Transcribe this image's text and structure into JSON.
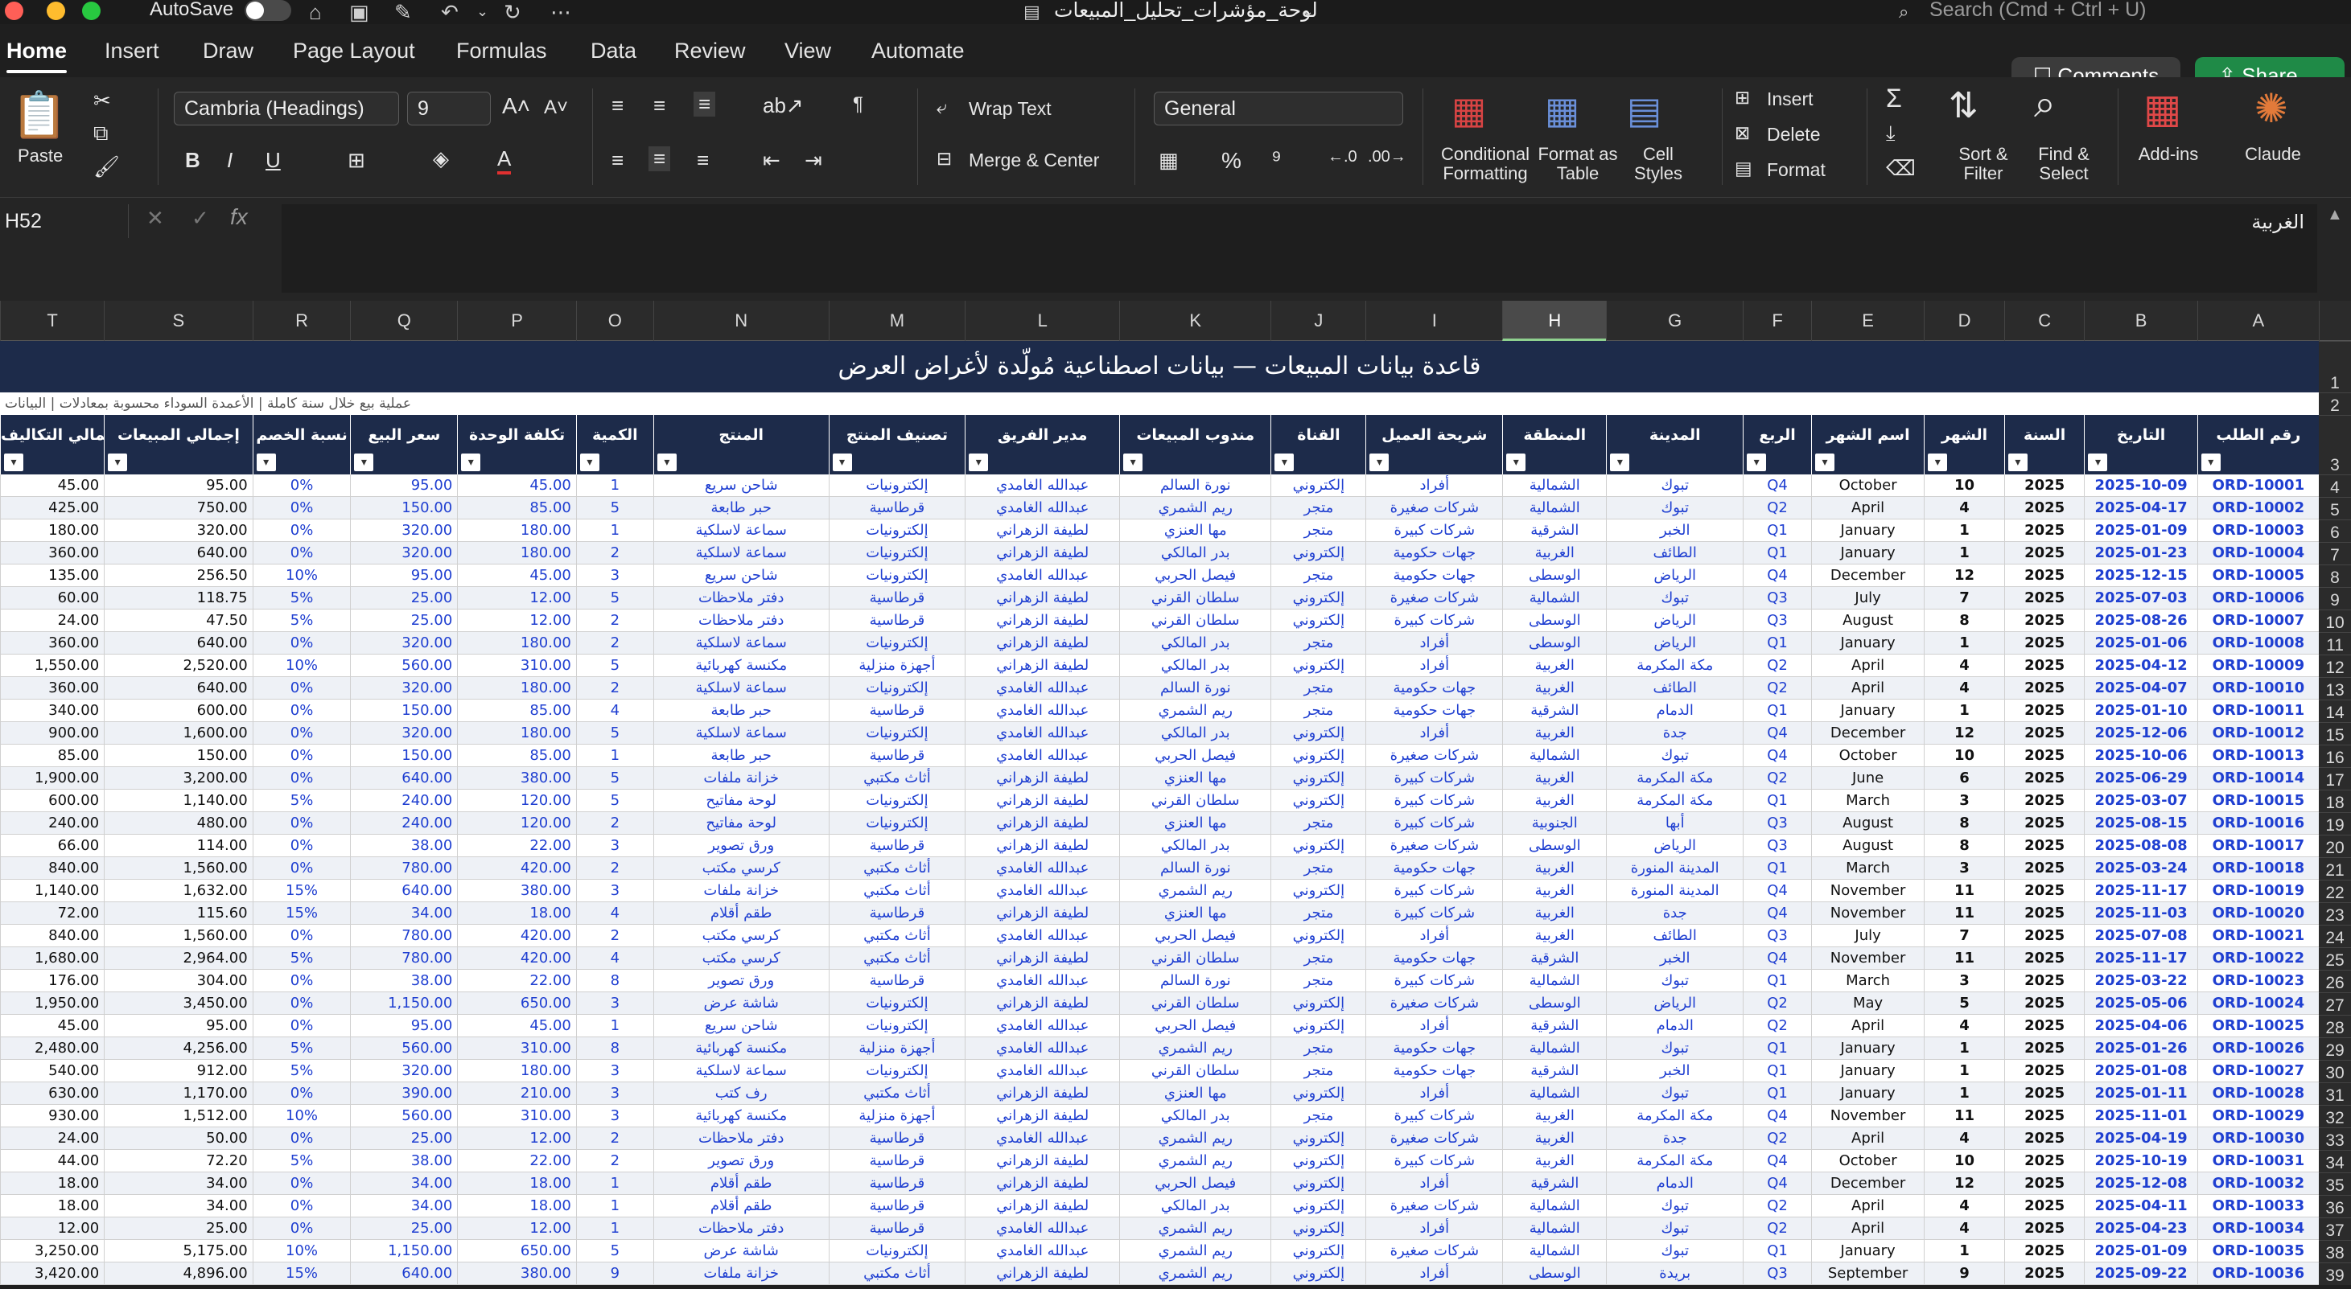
{
  "titlebar": {
    "autosave": "AutoSave",
    "doc_title": "لوحة_مؤشرات_تحليل_المبيعات",
    "search_placeholder": "Search (Cmd + Ctrl + U)"
  },
  "tabs": [
    "Home",
    "Insert",
    "Draw",
    "Page Layout",
    "Formulas",
    "Data",
    "Review",
    "View",
    "Automate"
  ],
  "actions": {
    "comments": "Comments",
    "share": "Share"
  },
  "ribbon": {
    "paste": "Paste",
    "font": "Cambria (Headings)",
    "size": "9",
    "wrap": "Wrap Text",
    "merge": "Merge & Center",
    "format": "General",
    "cond": "Conditional Formatting",
    "fmt_table": "Format as Table",
    "cell_styles": "Cell Styles",
    "insert": "Insert",
    "delete": "Delete",
    "format_cells": "Format",
    "sort": "Sort & Filter",
    "find": "Find & Select",
    "addins": "Add-ins",
    "claude": "Claude"
  },
  "formula_bar": {
    "name_box": "H52",
    "content": "الغربية"
  },
  "columns": [
    "T",
    "S",
    "R",
    "Q",
    "P",
    "O",
    "N",
    "M",
    "L",
    "K",
    "J",
    "I",
    "H",
    "G",
    "F",
    "E",
    "D",
    "C",
    "B",
    "A"
  ],
  "selected_column": "H",
  "row_numbers": [
    "1",
    "2",
    "3",
    "4",
    "5",
    "6",
    "7",
    "8",
    "9",
    "10",
    "11",
    "12",
    "13",
    "14",
    "15",
    "16",
    "17",
    "18",
    "19",
    "20",
    "21",
    "22",
    "23",
    "24",
    "25",
    "26",
    "27",
    "28",
    "29",
    "30",
    "31",
    "32",
    "33",
    "34",
    "35",
    "36",
    "37",
    "38",
    "39"
  ],
  "banner": "قاعدة بيانات المبيعات — بيانات اصطناعية مُولّدة لأغراض العرض",
  "note": "عملية بيع خلال سنة كاملة | الأعمدة السوداء محسوبة بمعادلات | البيانات",
  "headers": [
    "إجمالي التكاليف",
    "إجمالي المبيعات",
    "نسبة الخصم",
    "سعر البيع",
    "تكلفة الوحدة",
    "الكمية",
    "المنتج",
    "تصنيف المنتج",
    "مدير الفريق",
    "مندوب المبيعات",
    "القناة",
    "شريحة العميل",
    "المنطقة",
    "المدينة",
    "الربع",
    "اسم الشهر",
    "الشهر",
    "السنة",
    "التاريخ",
    "رقم الطلب"
  ],
  "rows": [
    [
      "45.00",
      "95.00",
      "0%",
      "95.00",
      "45.00",
      "1",
      "شاحن سريع",
      "إلكترونيات",
      "عبدالله الغامدي",
      "نورة السالم",
      "إلكتروني",
      "أفراد",
      "الشمالية",
      "تبوك",
      "Q4",
      "October",
      "10",
      "2025",
      "2025-10-09",
      "ORD-10001"
    ],
    [
      "425.00",
      "750.00",
      "0%",
      "150.00",
      "85.00",
      "5",
      "حبر طابعة",
      "قرطاسية",
      "عبدالله الغامدي",
      "ريم الشمري",
      "متجر",
      "شركات صغيرة",
      "الشمالية",
      "تبوك",
      "Q2",
      "April",
      "4",
      "2025",
      "2025-04-17",
      "ORD-10002"
    ],
    [
      "180.00",
      "320.00",
      "0%",
      "320.00",
      "180.00",
      "1",
      "سماعة لاسلكية",
      "إلكترونيات",
      "لطيفة الزهراني",
      "مها العنزي",
      "متجر",
      "شركات كبيرة",
      "الشرقية",
      "الخبر",
      "Q1",
      "January",
      "1",
      "2025",
      "2025-01-09",
      "ORD-10003"
    ],
    [
      "360.00",
      "640.00",
      "0%",
      "320.00",
      "180.00",
      "2",
      "سماعة لاسلكية",
      "إلكترونيات",
      "لطيفة الزهراني",
      "بدر المالكي",
      "إلكتروني",
      "جهات حكومية",
      "الغربية",
      "الطائف",
      "Q1",
      "January",
      "1",
      "2025",
      "2025-01-23",
      "ORD-10004"
    ],
    [
      "135.00",
      "256.50",
      "10%",
      "95.00",
      "45.00",
      "3",
      "شاحن سريع",
      "إلكترونيات",
      "عبدالله الغامدي",
      "فيصل الحربي",
      "متجر",
      "جهات حكومية",
      "الوسطى",
      "الرياض",
      "Q4",
      "December",
      "12",
      "2025",
      "2025-12-15",
      "ORD-10005"
    ],
    [
      "60.00",
      "118.75",
      "5%",
      "25.00",
      "12.00",
      "5",
      "دفتر ملاحظات",
      "قرطاسية",
      "لطيفة الزهراني",
      "سلطان القرني",
      "إلكتروني",
      "شركات صغيرة",
      "الشمالية",
      "تبوك",
      "Q3",
      "July",
      "7",
      "2025",
      "2025-07-03",
      "ORD-10006"
    ],
    [
      "24.00",
      "47.50",
      "5%",
      "25.00",
      "12.00",
      "2",
      "دفتر ملاحظات",
      "قرطاسية",
      "لطيفة الزهراني",
      "سلطان القرني",
      "إلكتروني",
      "شركات كبيرة",
      "الوسطى",
      "الرياض",
      "Q3",
      "August",
      "8",
      "2025",
      "2025-08-26",
      "ORD-10007"
    ],
    [
      "360.00",
      "640.00",
      "0%",
      "320.00",
      "180.00",
      "2",
      "سماعة لاسلكية",
      "إلكترونيات",
      "لطيفة الزهراني",
      "بدر المالكي",
      "متجر",
      "أفراد",
      "الوسطى",
      "الرياض",
      "Q1",
      "January",
      "1",
      "2025",
      "2025-01-06",
      "ORD-10008"
    ],
    [
      "1,550.00",
      "2,520.00",
      "10%",
      "560.00",
      "310.00",
      "5",
      "مكنسة كهربائية",
      "أجهزة منزلية",
      "لطيفة الزهراني",
      "بدر المالكي",
      "إلكتروني",
      "أفراد",
      "الغربية",
      "مكة المكرمة",
      "Q2",
      "April",
      "4",
      "2025",
      "2025-04-12",
      "ORD-10009"
    ],
    [
      "360.00",
      "640.00",
      "0%",
      "320.00",
      "180.00",
      "2",
      "سماعة لاسلكية",
      "إلكترونيات",
      "عبدالله الغامدي",
      "نورة السالم",
      "متجر",
      "جهات حكومية",
      "الغربية",
      "الطائف",
      "Q2",
      "April",
      "4",
      "2025",
      "2025-04-07",
      "ORD-10010"
    ],
    [
      "340.00",
      "600.00",
      "0%",
      "150.00",
      "85.00",
      "4",
      "حبر طابعة",
      "قرطاسية",
      "عبدالله الغامدي",
      "ريم الشمري",
      "متجر",
      "جهات حكومية",
      "الشرقية",
      "الدمام",
      "Q1",
      "January",
      "1",
      "2025",
      "2025-01-10",
      "ORD-10011"
    ],
    [
      "900.00",
      "1,600.00",
      "0%",
      "320.00",
      "180.00",
      "5",
      "سماعة لاسلكية",
      "إلكترونيات",
      "عبدالله الغامدي",
      "بدر المالكي",
      "إلكتروني",
      "أفراد",
      "الغربية",
      "جدة",
      "Q4",
      "December",
      "12",
      "2025",
      "2025-12-06",
      "ORD-10012"
    ],
    [
      "85.00",
      "150.00",
      "0%",
      "150.00",
      "85.00",
      "1",
      "حبر طابعة",
      "قرطاسية",
      "عبدالله الغامدي",
      "فيصل الحربي",
      "إلكتروني",
      "شركات صغيرة",
      "الشمالية",
      "تبوك",
      "Q4",
      "October",
      "10",
      "2025",
      "2025-10-06",
      "ORD-10013"
    ],
    [
      "1,900.00",
      "3,200.00",
      "0%",
      "640.00",
      "380.00",
      "5",
      "خزانة ملفات",
      "أثاث مكتبي",
      "لطيفة الزهراني",
      "مها العنزي",
      "إلكتروني",
      "شركات كبيرة",
      "الغربية",
      "مكة المكرمة",
      "Q2",
      "June",
      "6",
      "2025",
      "2025-06-29",
      "ORD-10014"
    ],
    [
      "600.00",
      "1,140.00",
      "5%",
      "240.00",
      "120.00",
      "5",
      "لوحة مفاتيح",
      "إلكترونيات",
      "لطيفة الزهراني",
      "سلطان القرني",
      "إلكتروني",
      "شركات كبيرة",
      "الغربية",
      "مكة المكرمة",
      "Q1",
      "March",
      "3",
      "2025",
      "2025-03-07",
      "ORD-10015"
    ],
    [
      "240.00",
      "480.00",
      "0%",
      "240.00",
      "120.00",
      "2",
      "لوحة مفاتيح",
      "إلكترونيات",
      "لطيفة الزهراني",
      "مها العنزي",
      "متجر",
      "شركات كبيرة",
      "الجنوبية",
      "أبها",
      "Q3",
      "August",
      "8",
      "2025",
      "2025-08-15",
      "ORD-10016"
    ],
    [
      "66.00",
      "114.00",
      "0%",
      "38.00",
      "22.00",
      "3",
      "ورق تصوير",
      "قرطاسية",
      "لطيفة الزهراني",
      "بدر المالكي",
      "إلكتروني",
      "شركات صغيرة",
      "الوسطى",
      "الرياض",
      "Q3",
      "August",
      "8",
      "2025",
      "2025-08-08",
      "ORD-10017"
    ],
    [
      "840.00",
      "1,560.00",
      "0%",
      "780.00",
      "420.00",
      "2",
      "كرسي مكتب",
      "أثاث مكتبي",
      "عبدالله الغامدي",
      "نورة السالم",
      "متجر",
      "جهات حكومية",
      "الغربية",
      "المدينة المنورة",
      "Q1",
      "March",
      "3",
      "2025",
      "2025-03-24",
      "ORD-10018"
    ],
    [
      "1,140.00",
      "1,632.00",
      "15%",
      "640.00",
      "380.00",
      "3",
      "خزانة ملفات",
      "أثاث مكتبي",
      "عبدالله الغامدي",
      "ريم الشمري",
      "إلكتروني",
      "شركات كبيرة",
      "الغربية",
      "المدينة المنورة",
      "Q4",
      "November",
      "11",
      "2025",
      "2025-11-17",
      "ORD-10019"
    ],
    [
      "72.00",
      "115.60",
      "15%",
      "34.00",
      "18.00",
      "4",
      "طقم أقلام",
      "قرطاسية",
      "لطيفة الزهراني",
      "مها العنزي",
      "متجر",
      "شركات كبيرة",
      "الغربية",
      "جدة",
      "Q4",
      "November",
      "11",
      "2025",
      "2025-11-03",
      "ORD-10020"
    ],
    [
      "840.00",
      "1,560.00",
      "0%",
      "780.00",
      "420.00",
      "2",
      "كرسي مكتب",
      "أثاث مكتبي",
      "عبدالله الغامدي",
      "فيصل الحربي",
      "إلكتروني",
      "أفراد",
      "الغربية",
      "الطائف",
      "Q3",
      "July",
      "7",
      "2025",
      "2025-07-08",
      "ORD-10021"
    ],
    [
      "1,680.00",
      "2,964.00",
      "5%",
      "780.00",
      "420.00",
      "4",
      "كرسي مكتب",
      "أثاث مكتبي",
      "لطيفة الزهراني",
      "سلطان القرني",
      "متجر",
      "جهات حكومية",
      "الشرقية",
      "الخبر",
      "Q4",
      "November",
      "11",
      "2025",
      "2025-11-17",
      "ORD-10022"
    ],
    [
      "176.00",
      "304.00",
      "0%",
      "38.00",
      "22.00",
      "8",
      "ورق تصوير",
      "قرطاسية",
      "عبدالله الغامدي",
      "نورة السالم",
      "متجر",
      "شركات كبيرة",
      "الشمالية",
      "تبوك",
      "Q1",
      "March",
      "3",
      "2025",
      "2025-03-22",
      "ORD-10023"
    ],
    [
      "1,950.00",
      "3,450.00",
      "0%",
      "1,150.00",
      "650.00",
      "3",
      "شاشة عرض",
      "إلكترونيات",
      "لطيفة الزهراني",
      "سلطان القرني",
      "إلكتروني",
      "شركات صغيرة",
      "الوسطى",
      "الرياض",
      "Q2",
      "May",
      "5",
      "2025",
      "2025-05-06",
      "ORD-10024"
    ],
    [
      "45.00",
      "95.00",
      "0%",
      "95.00",
      "45.00",
      "1",
      "شاحن سريع",
      "إلكترونيات",
      "عبدالله الغامدي",
      "فيصل الحربي",
      "إلكتروني",
      "أفراد",
      "الشرقية",
      "الدمام",
      "Q2",
      "April",
      "4",
      "2025",
      "2025-04-06",
      "ORD-10025"
    ],
    [
      "2,480.00",
      "4,256.00",
      "5%",
      "560.00",
      "310.00",
      "8",
      "مكنسة كهربائية",
      "أجهزة منزلية",
      "عبدالله الغامدي",
      "ريم الشمري",
      "متجر",
      "جهات حكومية",
      "الشمالية",
      "تبوك",
      "Q1",
      "January",
      "1",
      "2025",
      "2025-01-26",
      "ORD-10026"
    ],
    [
      "540.00",
      "912.00",
      "5%",
      "320.00",
      "180.00",
      "3",
      "سماعة لاسلكية",
      "إلكترونيات",
      "عبدالله الغامدي",
      "سلطان القرني",
      "متجر",
      "جهات حكومية",
      "الشرقية",
      "الخبر",
      "Q1",
      "January",
      "1",
      "2025",
      "2025-01-08",
      "ORD-10027"
    ],
    [
      "630.00",
      "1,170.00",
      "0%",
      "390.00",
      "210.00",
      "3",
      "رف كتب",
      "أثاث مكتبي",
      "لطيفة الزهراني",
      "مها العنزي",
      "إلكتروني",
      "أفراد",
      "الشمالية",
      "تبوك",
      "Q1",
      "January",
      "1",
      "2025",
      "2025-01-11",
      "ORD-10028"
    ],
    [
      "930.00",
      "1,512.00",
      "10%",
      "560.00",
      "310.00",
      "3",
      "مكنسة كهربائية",
      "أجهزة منزلية",
      "لطيفة الزهراني",
      "بدر المالكي",
      "متجر",
      "شركات كبيرة",
      "الغربية",
      "مكة المكرمة",
      "Q4",
      "November",
      "11",
      "2025",
      "2025-11-01",
      "ORD-10029"
    ],
    [
      "24.00",
      "50.00",
      "0%",
      "25.00",
      "12.00",
      "2",
      "دفتر ملاحظات",
      "قرطاسية",
      "عبدالله الغامدي",
      "ريم الشمري",
      "إلكتروني",
      "شركات صغيرة",
      "الغربية",
      "جدة",
      "Q2",
      "April",
      "4",
      "2025",
      "2025-04-19",
      "ORD-10030"
    ],
    [
      "44.00",
      "72.20",
      "5%",
      "38.00",
      "22.00",
      "2",
      "ورق تصوير",
      "قرطاسية",
      "لطيفة الزهراني",
      "ريم الشمري",
      "إلكتروني",
      "شركات كبيرة",
      "الغربية",
      "مكة المكرمة",
      "Q4",
      "October",
      "10",
      "2025",
      "2025-10-19",
      "ORD-10031"
    ],
    [
      "18.00",
      "34.00",
      "0%",
      "34.00",
      "18.00",
      "1",
      "طقم أقلام",
      "قرطاسية",
      "لطيفة الزهراني",
      "فيصل الحربي",
      "إلكتروني",
      "أفراد",
      "الشرقية",
      "الدمام",
      "Q4",
      "December",
      "12",
      "2025",
      "2025-12-08",
      "ORD-10032"
    ],
    [
      "18.00",
      "34.00",
      "0%",
      "34.00",
      "18.00",
      "1",
      "طقم أقلام",
      "قرطاسية",
      "لطيفة الزهراني",
      "بدر المالكي",
      "إلكتروني",
      "شركات صغيرة",
      "الشمالية",
      "تبوك",
      "Q2",
      "April",
      "4",
      "2025",
      "2025-04-11",
      "ORD-10033"
    ],
    [
      "12.00",
      "25.00",
      "0%",
      "25.00",
      "12.00",
      "1",
      "دفتر ملاحظات",
      "قرطاسية",
      "عبدالله الغامدي",
      "ريم الشمري",
      "إلكتروني",
      "أفراد",
      "الشمالية",
      "تبوك",
      "Q2",
      "April",
      "4",
      "2025",
      "2025-04-23",
      "ORD-10034"
    ],
    [
      "3,250.00",
      "5,175.00",
      "10%",
      "1,150.00",
      "650.00",
      "5",
      "شاشة عرض",
      "إلكترونيات",
      "عبدالله الغامدي",
      "ريم الشمري",
      "إلكتروني",
      "شركات صغيرة",
      "الشمالية",
      "تبوك",
      "Q1",
      "January",
      "1",
      "2025",
      "2025-01-09",
      "ORD-10035"
    ],
    [
      "3,420.00",
      "4,896.00",
      "15%",
      "640.00",
      "380.00",
      "9",
      "خزانة ملفات",
      "أثاث مكتبي",
      "لطيفة الزهراني",
      "ريم الشمري",
      "إلكتروني",
      "أفراد",
      "الوسطى",
      "بريدة",
      "Q3",
      "September",
      "9",
      "2025",
      "2025-09-22",
      "ORD-10036"
    ]
  ]
}
